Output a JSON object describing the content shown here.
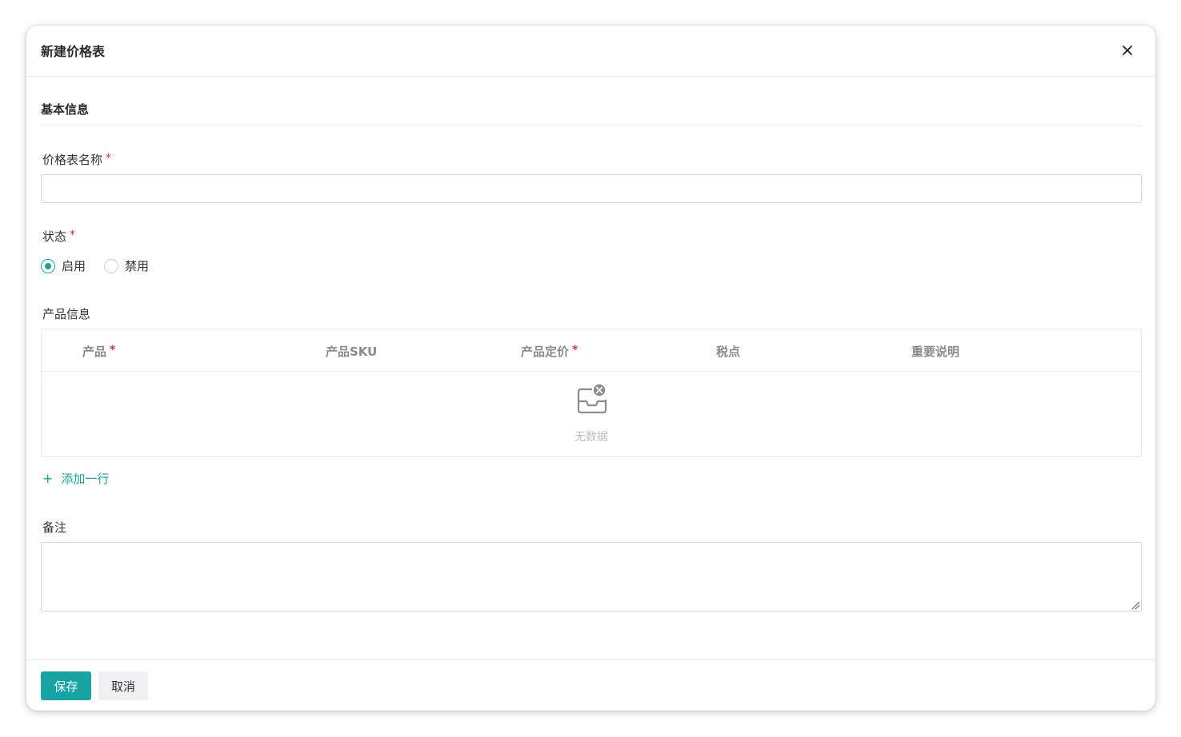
{
  "dialog": {
    "title": "新建价格表",
    "close_icon": "close-icon"
  },
  "basic": {
    "section_title": "基本信息"
  },
  "form": {
    "name_label": "价格表名称",
    "name_value": "",
    "required_mark": "*",
    "status_label": "状态",
    "status_options": [
      {
        "label": "启用",
        "checked": true
      },
      {
        "label": "禁用",
        "checked": false
      }
    ],
    "product_label": "产品信息",
    "remark_label": "备注",
    "remark_value": ""
  },
  "table": {
    "columns": [
      "产品",
      "产品SKU",
      "产品定价",
      "税点",
      "重要说明"
    ],
    "empty_text": "无数据",
    "empty_icon": "empty-inbox-icon"
  },
  "actions": {
    "add_row_plus": "+",
    "add_row": "添加一行",
    "save": "保存",
    "cancel": "取消"
  },
  "colors": {
    "accent": "#17a2a4",
    "required": "#e0302f"
  }
}
